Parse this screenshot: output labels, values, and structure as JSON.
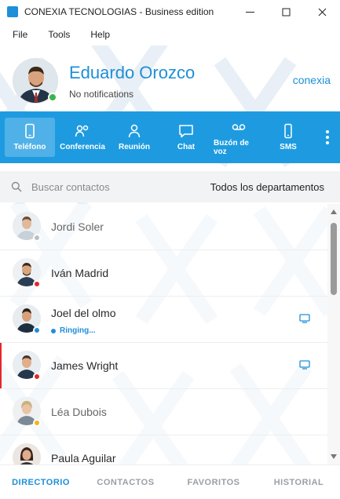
{
  "window": {
    "title": "CONEXIA TECNOLOGIAS - Business edition",
    "accent": "#1e9be0"
  },
  "menu": [
    "File",
    "Tools",
    "Help"
  ],
  "profile": {
    "name": "Eduardo Orozco",
    "status": "No notifications",
    "brand": "conexia",
    "presence_color": "#3cb44b"
  },
  "toolbar": {
    "items": [
      {
        "label": "Teléfono",
        "icon": "phone-icon",
        "active": true
      },
      {
        "label": "Conferencia",
        "icon": "conference-icon",
        "active": false
      },
      {
        "label": "Reunión",
        "icon": "person-icon",
        "active": false
      },
      {
        "label": "Chat",
        "icon": "chat-icon",
        "active": false
      },
      {
        "label": "Buzón de voz",
        "icon": "voicemail-icon",
        "active": false
      },
      {
        "label": "SMS",
        "icon": "mobile-icon",
        "active": false
      }
    ]
  },
  "search": {
    "placeholder": "Buscar contactos",
    "department": "Todos los departamentos"
  },
  "contacts": [
    {
      "name": "Jordi Soler",
      "presence": "#bdbdbd",
      "status": "",
      "screen": false
    },
    {
      "name": "Iván Madrid",
      "presence": "#e5262b",
      "status": "",
      "screen": false
    },
    {
      "name": "Joel del olmo",
      "presence": "#1e8fd8",
      "status": "Ringing...",
      "screen": true
    },
    {
      "name": "James Wright",
      "presence": "#e5262b",
      "status": "",
      "screen": true
    },
    {
      "name": "Léa Dubois",
      "presence": "#f2b51b",
      "status": "",
      "screen": false
    },
    {
      "name": "Paula Aguilar",
      "presence": "#bdbdbd",
      "status": "",
      "screen": false
    }
  ],
  "tabs": [
    {
      "label": "DIRECTORIO",
      "active": true
    },
    {
      "label": "CONTACTOS",
      "active": false
    },
    {
      "label": "FAVORITOS",
      "active": false
    },
    {
      "label": "HISTORIAL",
      "active": false
    }
  ]
}
